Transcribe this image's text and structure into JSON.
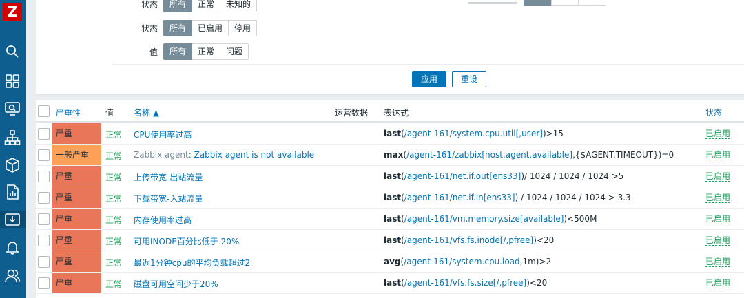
{
  "sidebar": {
    "logo": "Z",
    "icons": [
      "search-icon",
      "dashboard-icon",
      "monitoring-icon",
      "network-icon",
      "inventory-icon",
      "reports-icon",
      "data-collection-icon",
      "alerts-icon",
      "users-icon"
    ]
  },
  "filter": {
    "rows": [
      {
        "label": "状态",
        "options": [
          "所有",
          "正常",
          "未知的"
        ]
      },
      {
        "label": "状态",
        "options": [
          "所有",
          "已启用",
          "停用"
        ]
      },
      {
        "label": "值",
        "options": [
          "所有",
          "正常",
          "问题"
        ]
      }
    ],
    "apply_label": "应用",
    "reset_label": "重设"
  },
  "table": {
    "headers": {
      "severity": "严重性",
      "value": "值",
      "name": "名称 ▲",
      "operational_data": "运营数据",
      "expression": "表达式",
      "status": "状态"
    },
    "rows": [
      {
        "severity": "严重",
        "sev_color": "#e97659",
        "value": "正常",
        "host": "",
        "name": "CPU使用率过高",
        "func": "last",
        "ref": "/agent-161/system.cpu.util[,user]",
        "tail": ")>15",
        "status": "已启用"
      },
      {
        "severity": "一般严重",
        "sev_color": "#ffa059",
        "value": "正常",
        "host": "Zabbix agent",
        "name": "Zabbix agent is not available",
        "func": "max",
        "ref": "/agent-161/zabbix[host,agent,available]",
        "tail": ",{$AGENT.TIMEOUT})=0",
        "status": "已启用"
      },
      {
        "severity": "严重",
        "sev_color": "#e97659",
        "value": "正常",
        "host": "",
        "name": "上传带宽-出站流量",
        "func": "last",
        "ref": "/agent-161/net.if.out[ens33]",
        "tail": ")/ 1024 / 1024 / 1024 >5",
        "status": "已启用"
      },
      {
        "severity": "严重",
        "sev_color": "#e97659",
        "value": "正常",
        "host": "",
        "name": "下载带宽-入站流量",
        "func": "last",
        "ref": "/agent-161/net.if.in[ens33]",
        "tail": ") / 1024 / 1024 / 1024 > 3.3",
        "status": "已启用"
      },
      {
        "severity": "严重",
        "sev_color": "#e97659",
        "value": "正常",
        "host": "",
        "name": "内存使用率过高",
        "func": "last",
        "ref": "/agent-161/vm.memory.size[available]",
        "tail": ")<500M",
        "status": "已启用"
      },
      {
        "severity": "严重",
        "sev_color": "#e97659",
        "value": "正常",
        "host": "",
        "name": "可用INODE百分比低于 20%",
        "func": "last",
        "ref": "/agent-161/vfs.fs.inode[/,pfree]",
        "tail": ")<20",
        "status": "已启用"
      },
      {
        "severity": "严重",
        "sev_color": "#e97659",
        "value": "正常",
        "host": "",
        "name": "最近1分钟cpu的平均负载超过2",
        "func": "avg",
        "ref": "/agent-161/system.cpu.load",
        "tail": ",1m)>2",
        "status": "已启用"
      },
      {
        "severity": "严重",
        "sev_color": "#e97659",
        "value": "正常",
        "host": "",
        "name": "磁盘可用空间少于20%",
        "func": "last",
        "ref": "/agent-161/vfs.fs.size[/,pfree]",
        "tail": ")<20",
        "status": "已启用"
      }
    ]
  }
}
